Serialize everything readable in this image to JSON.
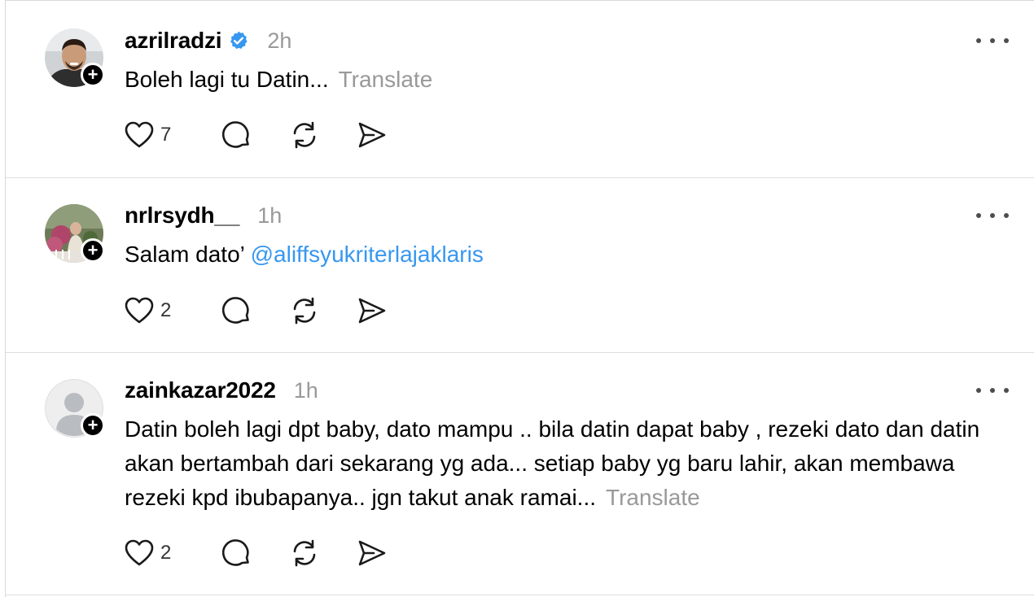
{
  "posts": [
    {
      "username": "azrilradzi",
      "verified": true,
      "time": "2h",
      "text": "Boleh lagi tu Datin...",
      "mention": "",
      "translate": "Translate",
      "likes": "7",
      "avatar": "photo-man"
    },
    {
      "username": "nrlrsydh__",
      "verified": false,
      "time": "1h",
      "text": "Salam dato’ ",
      "mention": "@aliffsyukriterlajaklaris",
      "translate": "",
      "likes": "2",
      "avatar": "photo-garden"
    },
    {
      "username": "zainkazar2022",
      "verified": false,
      "time": "1h",
      "text": "Datin boleh lagi dpt baby, dato mampu .. bila datin dapat baby , rezeki dato dan datin akan bertambah dari sekarang yg ada... setiap baby yg baru lahir, akan membawa rezeki kpd ibubapanya.. jgn takut anak ramai...",
      "mention": "",
      "translate": "Translate",
      "likes": "2",
      "avatar": "default-user"
    }
  ],
  "colors": {
    "accent": "#3797f0",
    "muted": "#999999",
    "divider": "#dedede"
  },
  "icons": [
    "heart-icon",
    "comment-icon",
    "repost-icon",
    "share-icon",
    "more-icon",
    "verified-badge-icon",
    "follow-plus-icon"
  ]
}
